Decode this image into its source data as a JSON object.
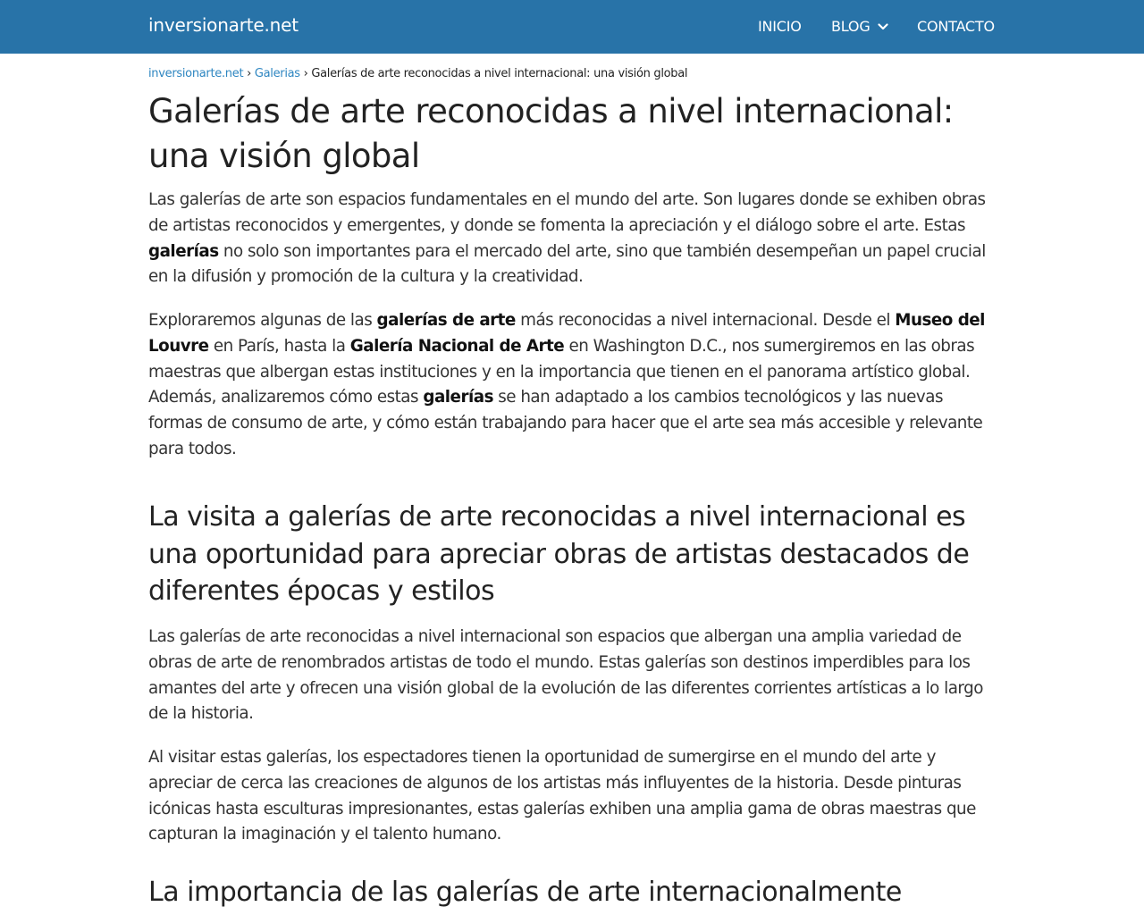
{
  "header": {
    "brand": "inversionarte.net",
    "nav": {
      "inicio": "INICIO",
      "blog": "BLOG",
      "contacto": "CONTACTO"
    },
    "background_color": "#2873a8"
  },
  "breadcrumb": {
    "home": "inversionarte.net",
    "separator": "›",
    "category": "Galerias",
    "current": "Galerías de arte reconocidas a nivel internacional: una visión global"
  },
  "article": {
    "title": "Galerías de arte reconocidas a nivel internacional: una visión global",
    "p1": {
      "t1": "Las galerías de arte son espacios fundamentales en el mundo del arte. Son lugares donde se exhiben obras de artistas reconocidos y emergentes, y donde se fomenta la apreciación y el diálogo sobre el arte. Estas ",
      "b1": "galerías",
      "t2": " no solo son importantes para el mercado del arte, sino que también desempeñan un papel crucial en la difusión y promoción de la cultura y la creatividad."
    },
    "p2": {
      "t1": "Exploraremos algunas de las ",
      "b1": "galerías de arte",
      "t2": " más reconocidas a nivel internacional. Desde el ",
      "b2": "Museo del Louvre",
      "t3": " en París, hasta la ",
      "b3": "Galería Nacional de Arte",
      "t4": " en Washington D.C., nos sumergiremos en las obras maestras que albergan estas instituciones y en la importancia que tienen en el panorama artístico global. Además, analizaremos cómo estas ",
      "b4": "galerías",
      "t5": " se han adaptado a los cambios tecnológicos y las nuevas formas de consumo de arte, y cómo están trabajando para hacer que el arte sea más accesible y relevante para todos."
    },
    "h2a": "La visita a galerías de arte reconocidas a nivel internacional es una oportunidad para apreciar obras de artistas destacados de diferentes épocas y estilos",
    "p3": "Las galerías de arte reconocidas a nivel internacional son espacios que albergan una amplia variedad de obras de arte de renombrados artistas de todo el mundo. Estas galerías son destinos imperdibles para los amantes del arte y ofrecen una visión global de la evolución de las diferentes corrientes artísticas a lo largo de la historia.",
    "p4": "Al visitar estas galerías, los espectadores tienen la oportunidad de sumergirse en el mundo del arte y apreciar de cerca las creaciones de algunos de los artistas más influyentes de la historia. Desde pinturas icónicas hasta esculturas impresionantes, estas galerías exhiben una amplia gama de obras maestras que capturan la imaginación y el talento humano.",
    "h2b": "La importancia de las galerías de arte internacionalmente"
  }
}
